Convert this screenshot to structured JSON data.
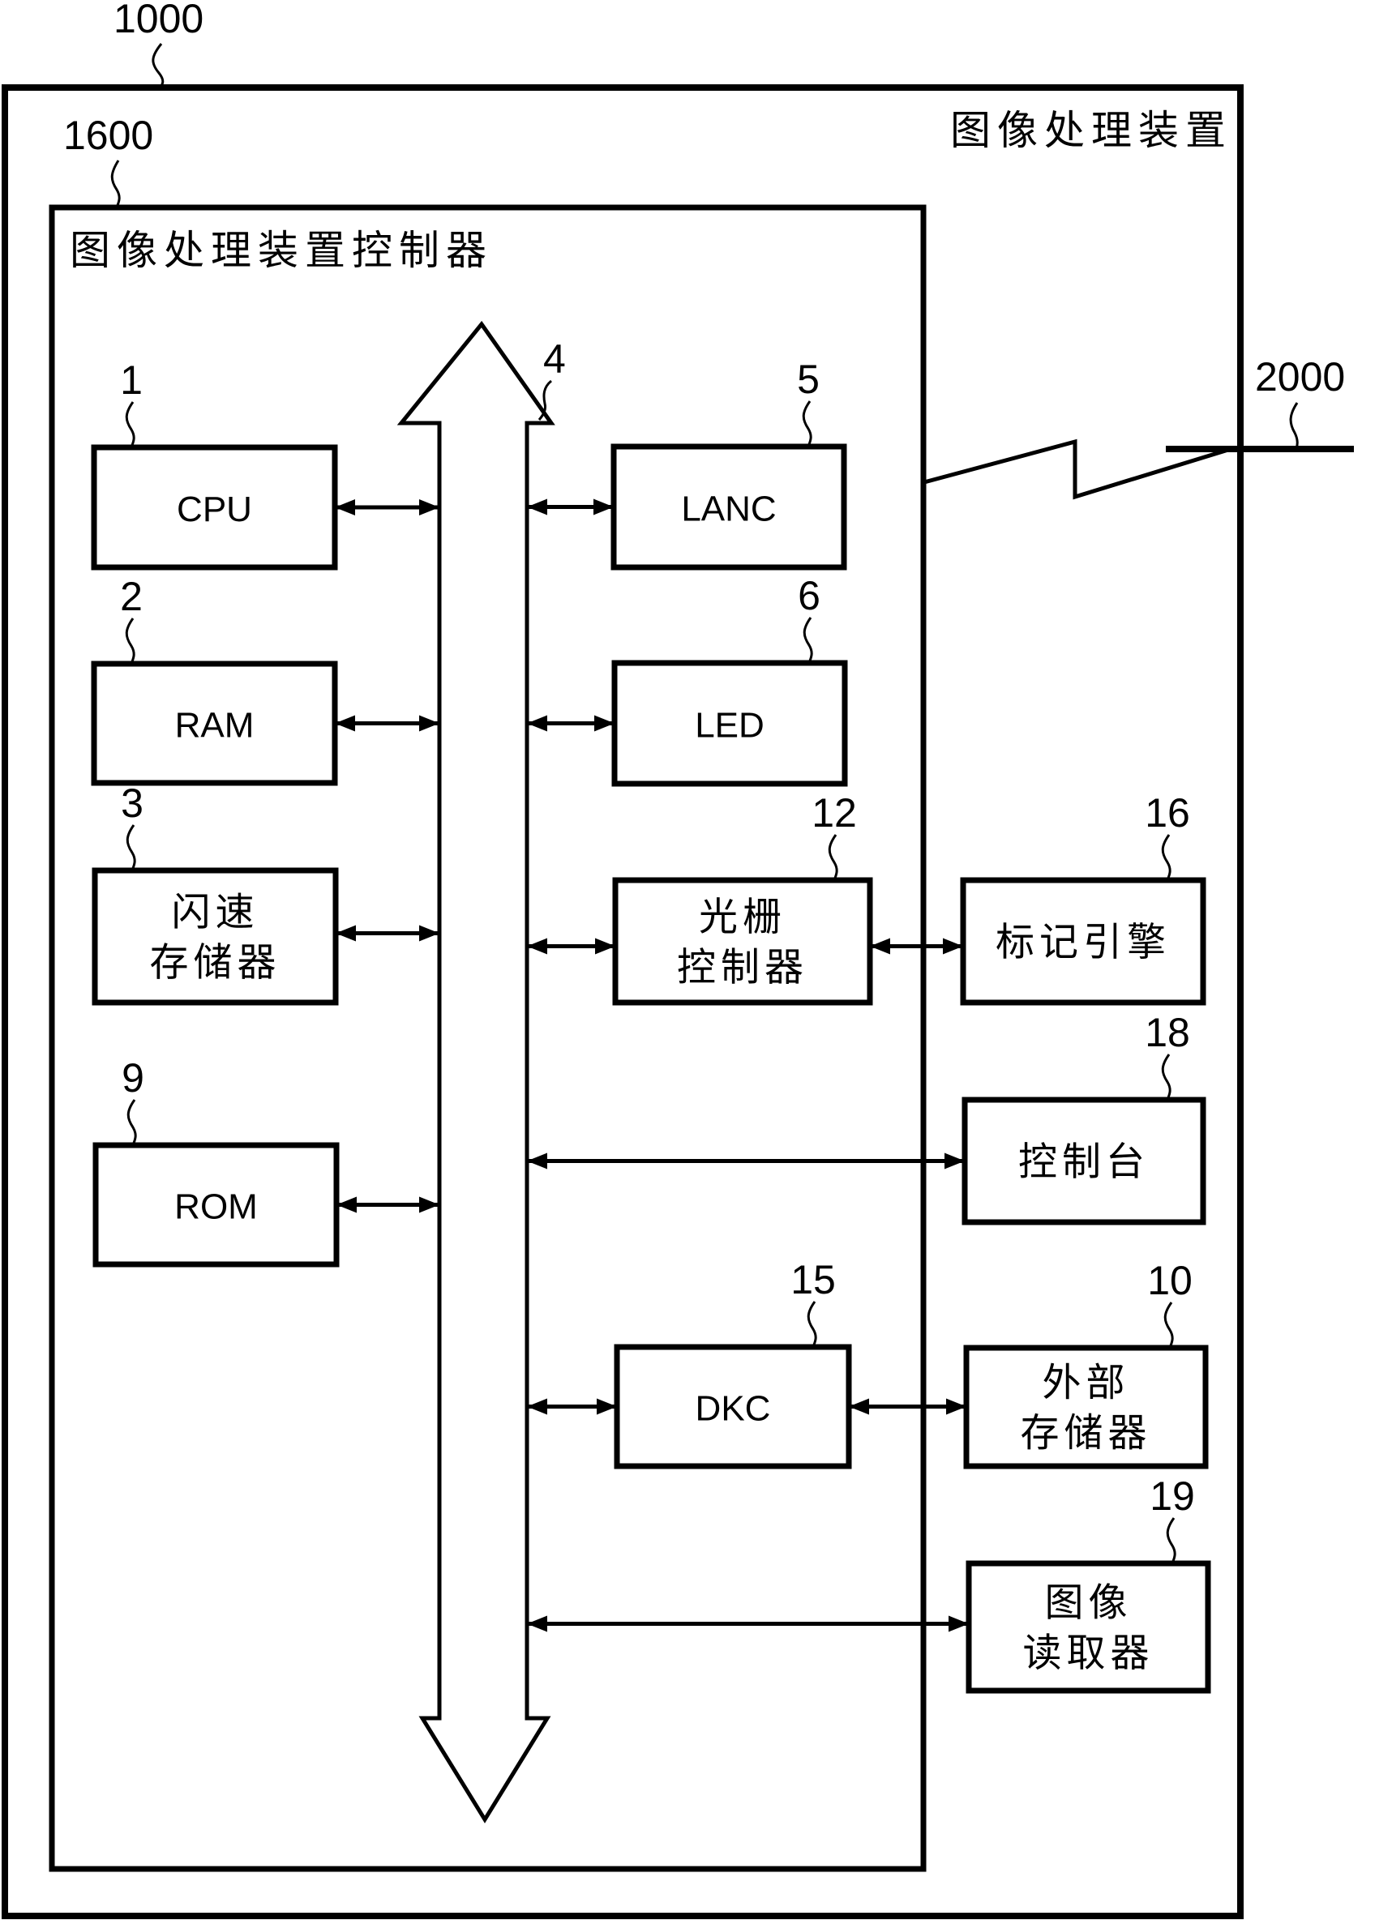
{
  "figure": {
    "apparatus": {
      "ref": "1000",
      "label": "图像处理装置"
    },
    "controller": {
      "ref": "1600",
      "label": "图像处理装置控制器"
    },
    "bus": {
      "ref": "4"
    },
    "network": {
      "ref": "2000"
    },
    "blocks": {
      "cpu": {
        "ref": "1",
        "lines": [
          "CPU"
        ]
      },
      "ram": {
        "ref": "2",
        "lines": [
          "RAM"
        ]
      },
      "flash": {
        "ref": "3",
        "lines": [
          "闪速",
          "存储器"
        ]
      },
      "rom": {
        "ref": "9",
        "lines": [
          "ROM"
        ]
      },
      "lanc": {
        "ref": "5",
        "lines": [
          "LANC"
        ]
      },
      "led": {
        "ref": "6",
        "lines": [
          "LED"
        ]
      },
      "raster": {
        "ref": "12",
        "lines": [
          "光栅",
          "控制器"
        ]
      },
      "engine": {
        "ref": "16",
        "lines": [
          "标记引擎"
        ]
      },
      "console": {
        "ref": "18",
        "lines": [
          "控制台"
        ]
      },
      "dkc": {
        "ref": "15",
        "lines": [
          "DKC"
        ]
      },
      "storage": {
        "ref": "10",
        "lines": [
          "外部",
          "存储器"
        ]
      },
      "reader": {
        "ref": "19",
        "lines": [
          "图像",
          "读取器"
        ]
      }
    },
    "connections": [
      {
        "from": "cpu",
        "to": "bus",
        "type": "bidirectional"
      },
      {
        "from": "ram",
        "to": "bus",
        "type": "bidirectional"
      },
      {
        "from": "flash",
        "to": "bus",
        "type": "bidirectional"
      },
      {
        "from": "rom",
        "to": "bus",
        "type": "bidirectional"
      },
      {
        "from": "bus",
        "to": "lanc",
        "type": "bidirectional"
      },
      {
        "from": "bus",
        "to": "led",
        "type": "bidirectional"
      },
      {
        "from": "bus",
        "to": "raster",
        "type": "bidirectional"
      },
      {
        "from": "raster",
        "to": "engine",
        "type": "bidirectional"
      },
      {
        "from": "bus",
        "to": "console",
        "type": "bidirectional"
      },
      {
        "from": "bus",
        "to": "dkc",
        "type": "bidirectional"
      },
      {
        "from": "dkc",
        "to": "storage",
        "type": "bidirectional"
      },
      {
        "from": "bus",
        "to": "reader",
        "type": "bidirectional"
      },
      {
        "from": "apparatus",
        "to": "network",
        "type": "network-link"
      }
    ]
  }
}
